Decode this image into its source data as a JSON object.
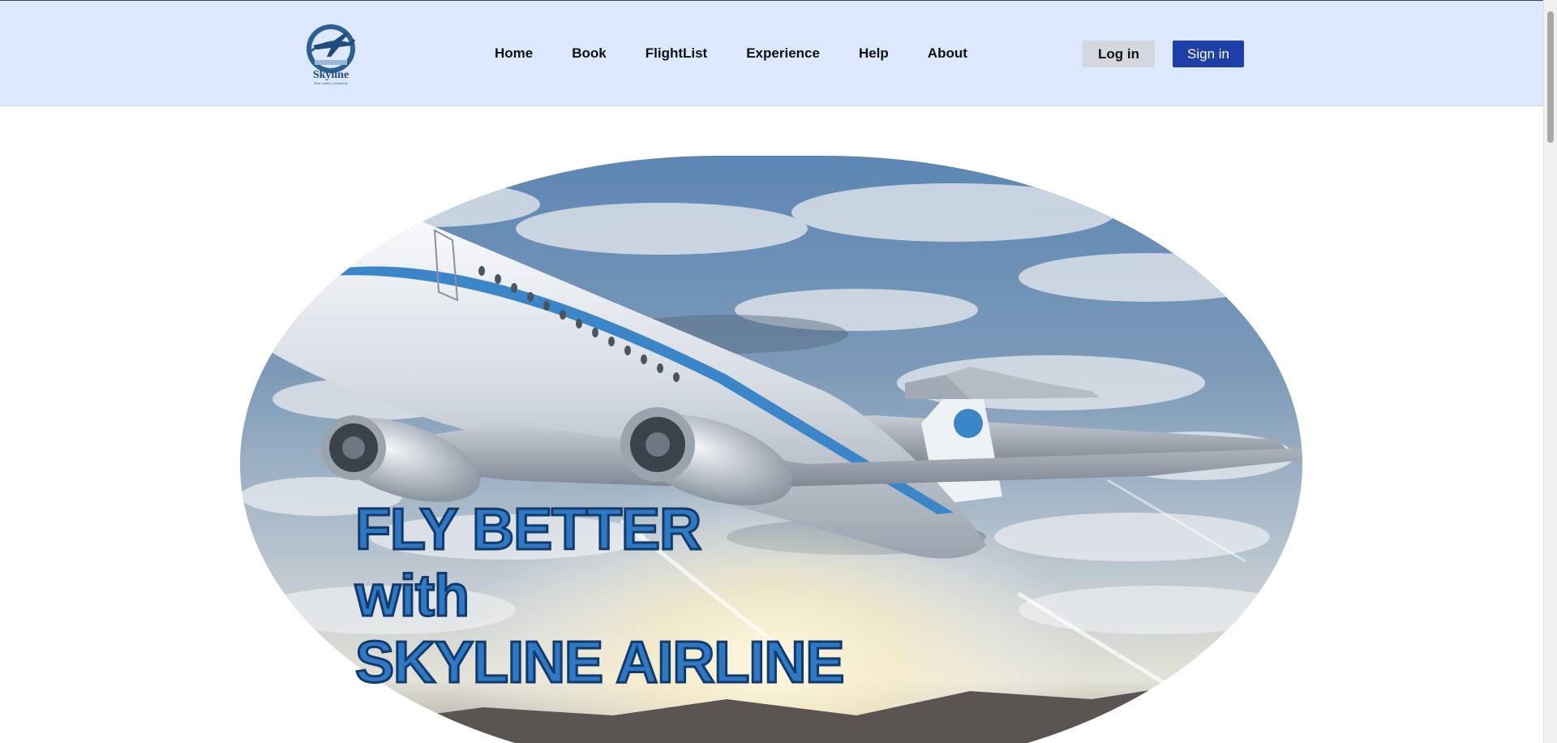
{
  "header": {
    "logo": {
      "text": "Skyline",
      "tagline": "Your comfort, our priority",
      "icon": "airplane-globe-logo"
    },
    "nav": [
      {
        "label": "Home"
      },
      {
        "label": "Book"
      },
      {
        "label": "FlightList"
      },
      {
        "label": "Experience"
      },
      {
        "label": "Help"
      },
      {
        "label": "About"
      }
    ],
    "login_label": "Log in",
    "signin_label": "Sign in"
  },
  "hero": {
    "line1": "FLY BETTER",
    "line2": "with",
    "line3": "SKYLINE AIRLINE",
    "image": "airplane-flying-over-clouds-sunset"
  },
  "colors": {
    "nav_bg": "#dbe8fd",
    "signin_bg": "#1e3ea8",
    "hero_text": "#2e78c4",
    "hero_stroke": "#123a6a"
  }
}
